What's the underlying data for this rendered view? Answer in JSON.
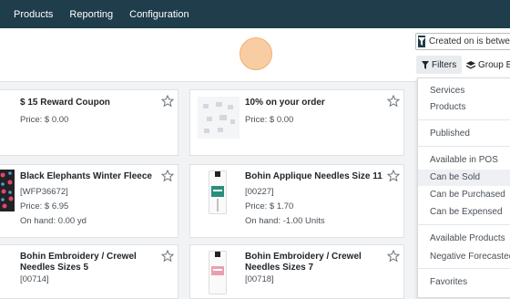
{
  "topbar": {
    "menus": [
      "Products",
      "Reporting",
      "Configuration"
    ]
  },
  "search": {
    "facet": "Created on is between"
  },
  "buttons": {
    "filters": "Filters",
    "group_by": "Group By"
  },
  "cards": [
    {
      "name": "$ 15 Reward Coupon",
      "ref": "",
      "price": "Price: $ 0.00",
      "onhand": ""
    },
    {
      "name": "10% on your order",
      "ref": "",
      "price": "Price: $ 0.00",
      "onhand": ""
    },
    {
      "name": "Black Elephants Winter Fleece",
      "ref": "[WFP36672]",
      "price": "Price: $ 6.95",
      "onhand": "On hand: 0.00 yd"
    },
    {
      "name": "Bohin Applique Needles Size 11",
      "ref": "[00227]",
      "price": "Price: $ 1.70",
      "onhand": "On hand: -1.00 Units"
    },
    {
      "name": "Bohin Embroidery / Crewel Needles Sizes 5",
      "ref": "[00714]",
      "price": "",
      "onhand": ""
    },
    {
      "name": "Bohin Embroidery / Crewel Needles Sizes 7",
      "ref": "[00718]",
      "price": "",
      "onhand": ""
    }
  ],
  "filters_menu": {
    "items": [
      "Services",
      "Products",
      "Published",
      "Available in POS",
      "Can be Sold",
      "Can be Purchased",
      "Can be Expensed",
      "Available Products",
      "Negative Forecasted",
      "Favorites"
    ],
    "highlighted": "Can be Sold"
  },
  "colors": {
    "topbar": "#1f3d4a",
    "accent": "#f8c89a"
  }
}
